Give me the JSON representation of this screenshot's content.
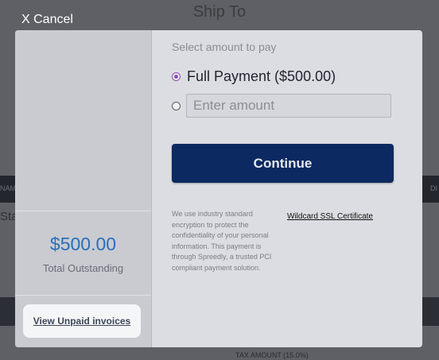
{
  "background": {
    "title": "Ship To",
    "left_fragment": "NAM",
    "right_fragment": "DI",
    "status_fragment": "Sta",
    "tax_fragment": "TAX AMOUNT (15.0%)"
  },
  "cancel_label": "X Cancel",
  "sidebar": {
    "amount": "$500.00",
    "amount_label": "Total Outstanding",
    "invoices_link": "View Unpaid invoices"
  },
  "payment": {
    "select_label": "Select amount to pay",
    "full_option_label": "Full Payment ($500.00)",
    "custom_placeholder": "Enter amount",
    "continue_label": "Continue",
    "security_text": "We use industry standard encryption to protect the confidentiality of your personal information. This payment is through Spreedly, a trusted PCI compliant payment solution.",
    "ssl_link": "Wildcard SSL Certificate"
  },
  "colors": {
    "accent": "#0d2961",
    "amount": "#2a6fb8",
    "radio_selected": "#8d4fb0"
  }
}
